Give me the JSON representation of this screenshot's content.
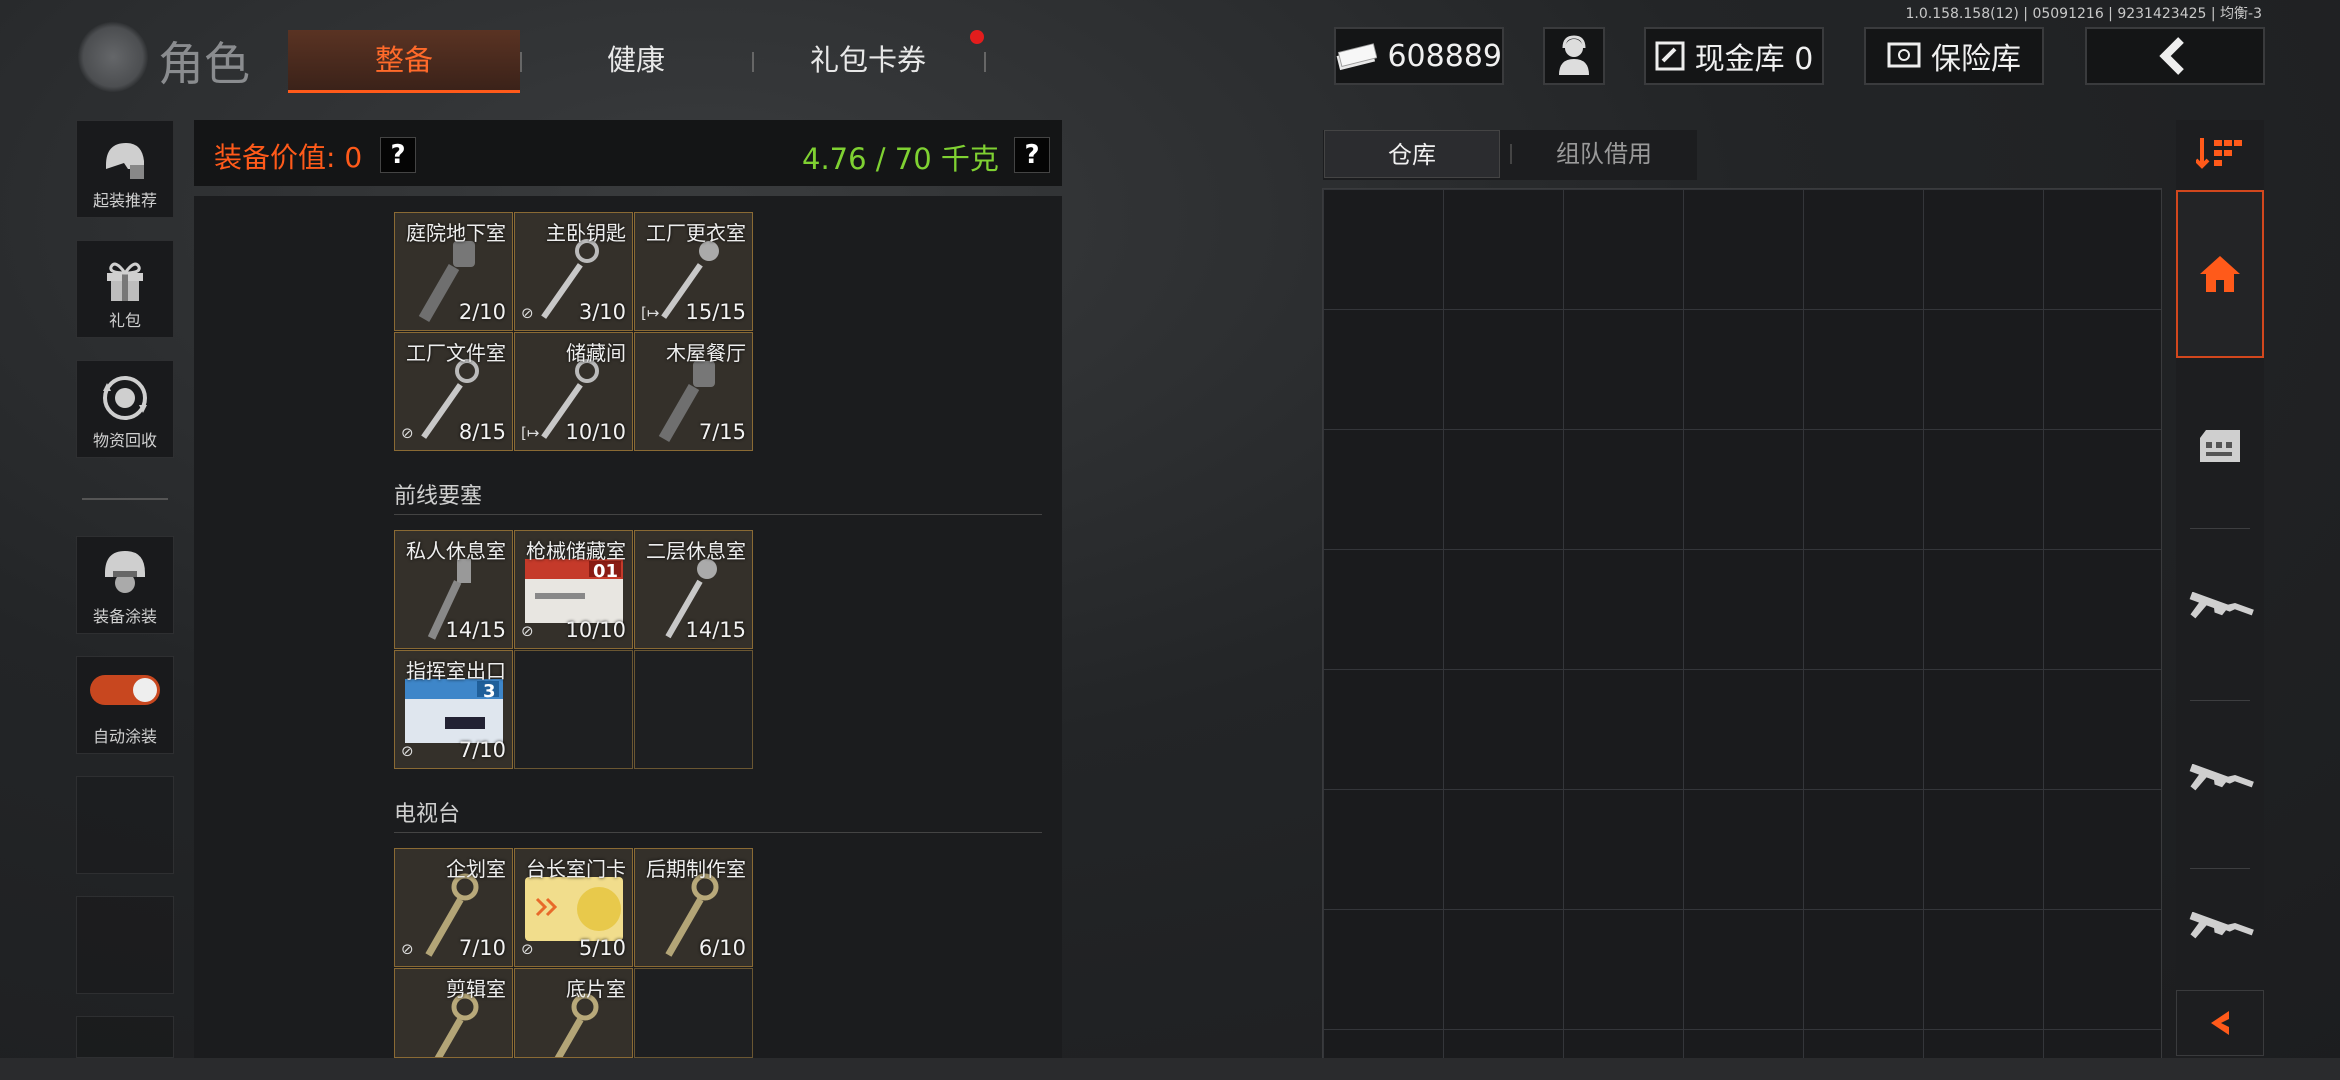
{
  "version_text": "1.0.158.158(12) | 05091216 | 9231423425 | 均衡-3",
  "header": {
    "title": "角色",
    "tabs": [
      {
        "label": "整备",
        "active": true
      },
      {
        "label": "健康",
        "active": false
      },
      {
        "label": "礼包卡券",
        "active": false,
        "badge": true
      }
    ],
    "currency": "608889",
    "cash_vault": "现金库 0",
    "safe_box": "保险库"
  },
  "sidebar": {
    "items": [
      {
        "label": "起装推荐",
        "icon": "helmet-recommend-icon"
      },
      {
        "label": "礼包",
        "icon": "gift-icon"
      },
      {
        "label": "物资回收",
        "icon": "recycle-icon"
      },
      {
        "label": "装备涂装",
        "icon": "helmet-paint-icon"
      },
      {
        "label": "自动涂装",
        "icon": "toggle-switch",
        "toggle_on": true
      }
    ]
  },
  "equipment": {
    "value_label": "装备价值: 0",
    "weight": "4.76 / 70 千克",
    "help": "?",
    "sections": [
      {
        "title": "",
        "items": [
          {
            "name": "庭院地下室",
            "count": "2/10",
            "tag": ""
          },
          {
            "name": "主卧钥匙",
            "count": "3/10",
            "tag": "⊘"
          },
          {
            "name": "工厂更衣室",
            "count": "15/15",
            "tag": "[↦"
          },
          {
            "name": "工厂文件室",
            "count": "8/15",
            "tag": "⊘"
          },
          {
            "name": "储藏间",
            "count": "10/10",
            "tag": "[↦"
          },
          {
            "name": "木屋餐厅",
            "count": "7/15",
            "tag": ""
          }
        ]
      },
      {
        "title": "前线要塞",
        "items": [
          {
            "name": "私人休息室",
            "count": "14/15",
            "tag": ""
          },
          {
            "name": "枪械储藏室",
            "count": "10/10",
            "tag": "⊘",
            "card": "01"
          },
          {
            "name": "二层休息室",
            "count": "14/15",
            "tag": ""
          },
          {
            "name": "指挥室出口",
            "count": "7/10",
            "tag": "⊘",
            "card": "3"
          }
        ]
      },
      {
        "title": "电视台",
        "items": [
          {
            "name": "企划室",
            "count": "7/10",
            "tag": "⊘"
          },
          {
            "name": "台长室门卡",
            "count": "5/10",
            "tag": "⊘",
            "card": "yellow"
          },
          {
            "name": "后期制作室",
            "count": "6/10",
            "tag": ""
          },
          {
            "name": "剪辑室",
            "count": "",
            "tag": ""
          },
          {
            "name": "底片室",
            "count": "",
            "tag": ""
          }
        ]
      }
    ]
  },
  "warehouse": {
    "tabs": [
      {
        "label": "仓库",
        "active": true
      },
      {
        "label": "组队借用",
        "active": false
      }
    ]
  },
  "colors": {
    "accent": "#ff5a1a",
    "weight_green": "#7fd132",
    "cell_border": "#8a6a34"
  }
}
